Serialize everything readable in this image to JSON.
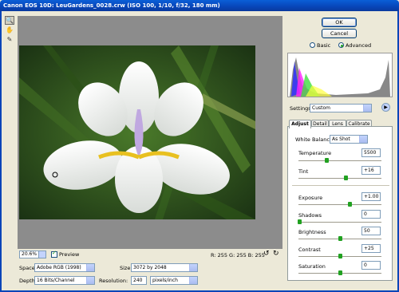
{
  "window": {
    "title": "Canon EOS 10D:  LeuGardens_0028.crw  (ISO 100, 1/10, f/32, 180 mm)"
  },
  "toolbar": {
    "tools": [
      "zoom-tool",
      "hand-tool",
      "eyedropper-tool"
    ]
  },
  "preview": {
    "zoom": "20.6%",
    "preview_label": "Preview",
    "preview_checked": true,
    "rgb_readout": "R: 255  G: 255  B: 255"
  },
  "workflow": {
    "space_label": "Space:",
    "space_value": "Adobe RGB (1998)",
    "depth_label": "Depth:",
    "depth_value": "16 Bits/Channel",
    "size_label": "Size:",
    "size_value": "3072 by 2048",
    "resolution_label": "Resolution:",
    "resolution_value": "240",
    "resolution_unit": "pixels/inch"
  },
  "buttons": {
    "ok": "OK",
    "cancel": "Cancel"
  },
  "mode": {
    "basic": "Basic",
    "advanced": "Advanced",
    "selected": "Advanced"
  },
  "settings": {
    "label": "Settings:",
    "value": "Custom"
  },
  "tabs": [
    {
      "label": "Adjust",
      "active": true
    },
    {
      "label": "Detail",
      "active": false
    },
    {
      "label": "Lens",
      "active": false
    },
    {
      "label": "Calibrate",
      "active": false
    }
  ],
  "adjust": {
    "white_balance_label": "White Balance:",
    "white_balance_value": "As Shot",
    "temperature_label": "Temperature",
    "temperature": "5500",
    "tint_label": "Tint",
    "tint": "+16",
    "exposure_label": "Exposure",
    "exposure": "+1.00",
    "shadows_label": "Shadows",
    "shadows": "0",
    "brightness_label": "Brightness",
    "brightness": "50",
    "contrast_label": "Contrast",
    "contrast": "+25",
    "saturation_label": "Saturation",
    "saturation": "0"
  },
  "colors": {
    "title_bar": "#0845b8",
    "slider_thumb": "#21a121",
    "canvas_bg": "#8c8c8c"
  }
}
